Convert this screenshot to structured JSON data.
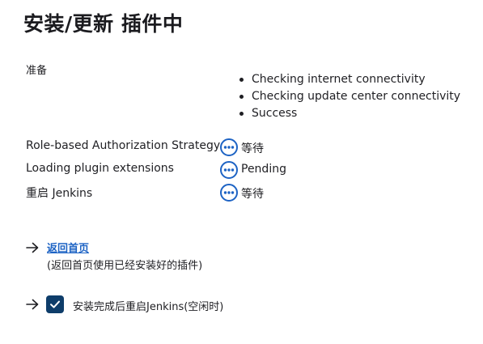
{
  "title": "安装/更新 插件中",
  "preparation": {
    "label": "准备",
    "checks": [
      "Checking internet connectivity",
      "Checking update center connectivity",
      "Success"
    ]
  },
  "plugins": [
    {
      "name": "Role-based Authorization Strategy",
      "status": "等待",
      "icon": "pending-icon"
    },
    {
      "name": "Loading plugin extensions",
      "status": "Pending",
      "icon": "pending-icon"
    },
    {
      "name": "重启 Jenkins",
      "status": "等待",
      "icon": "pending-icon"
    }
  ],
  "home": {
    "link_label": "返回首页",
    "note": "(返回首页使用已经安装好的插件)",
    "icon": "arrow-right-icon"
  },
  "restart": {
    "label": "安装完成后重启Jenkins(空闲时)",
    "checked": true,
    "icon": "arrow-right-icon"
  },
  "colors": {
    "link": "#1d63c4",
    "pending_icon": "#1d63c4",
    "checkbox": "#0e3d6a",
    "text": "#1f1f23"
  }
}
